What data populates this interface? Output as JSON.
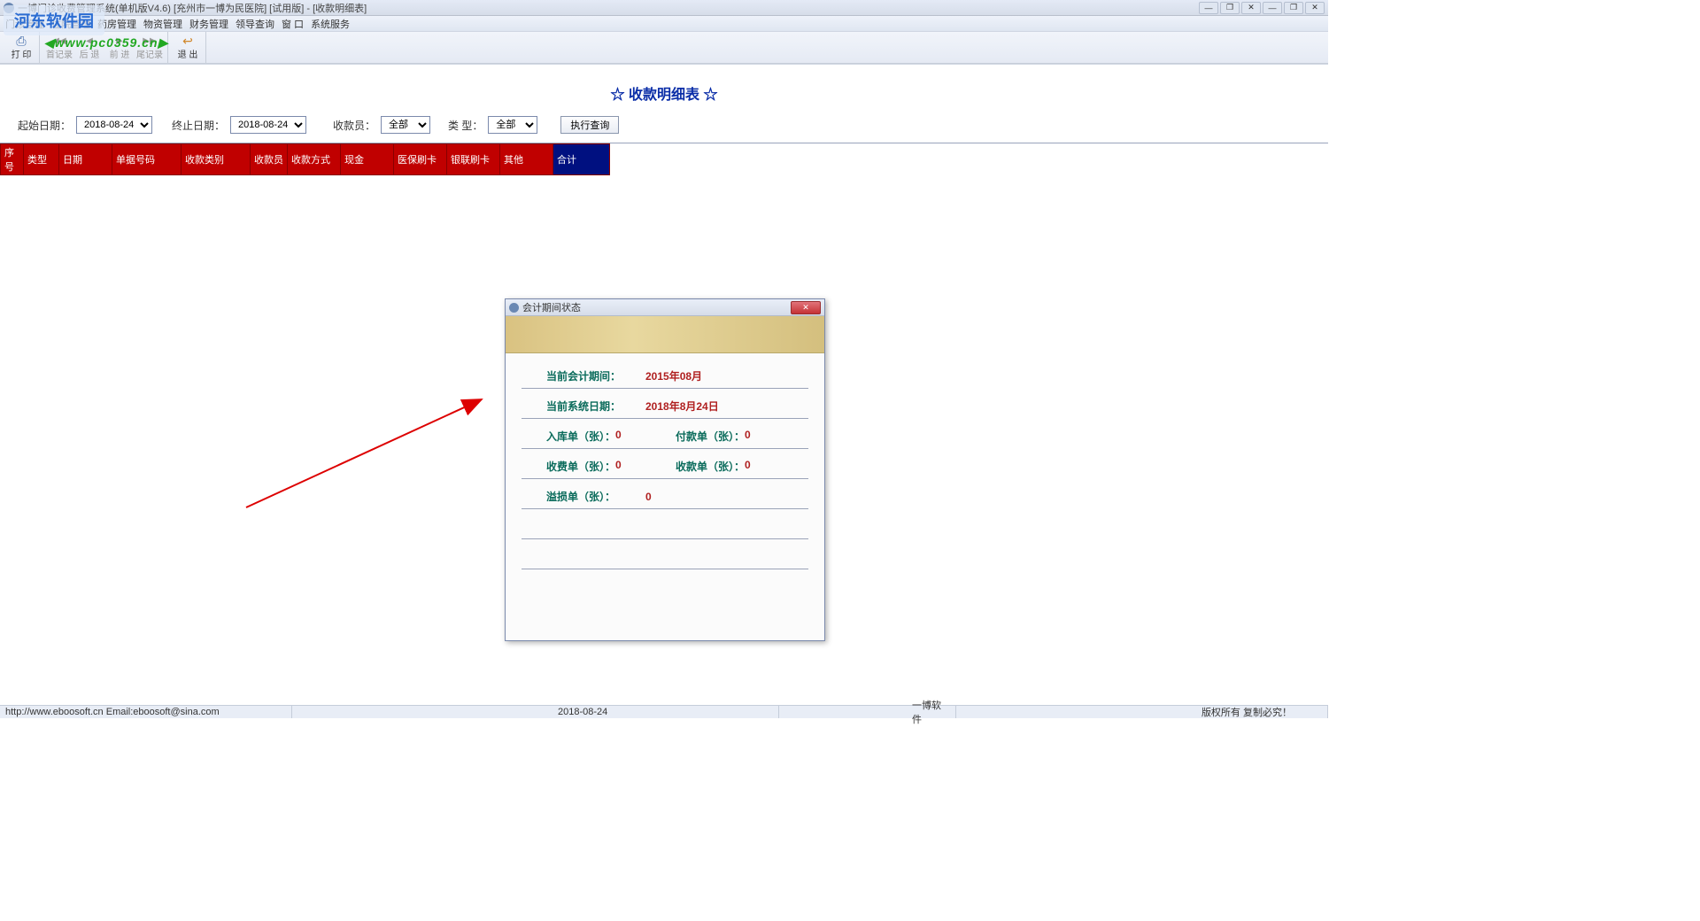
{
  "window": {
    "title": "一博门诊收费管理系统(单机版V4.6)    [充州市一博为民医院]  [试用版] - [收款明细表]"
  },
  "watermark": {
    "logo": "河东软件园",
    "url": "◀www.pc0359.cn▶"
  },
  "menus": [
    "门诊管理",
    "住院管理",
    "药房管理",
    "物资管理",
    "财务管理",
    "领导查询",
    "窗 口",
    "系统服务"
  ],
  "toolbar": {
    "print": "打 印",
    "first": "首记录",
    "back": "后 退",
    "forward": "前 进",
    "last": "尾记录",
    "exit": "退 出"
  },
  "page_title": "☆  收款明细表  ☆",
  "filters": {
    "start_label": "起始日期：",
    "start_value": "2018-08-24",
    "end_label": "终止日期：",
    "end_value": "2018-08-24",
    "cashier_label": "收款员：",
    "cashier_value": "全部",
    "type_label": "类  型：",
    "type_value": "全部",
    "run": "执行查询"
  },
  "table": {
    "columns": [
      "序号",
      "类型",
      "日期",
      "单据号码",
      "收款类别",
      "收款员",
      "收款方式",
      "现金",
      "医保刷卡",
      "银联刷卡",
      "其他",
      "合计"
    ]
  },
  "dialog": {
    "title": "会计期间状态",
    "rows": {
      "period_label": "当前会计期间：",
      "period_value": "2015年08月",
      "sysdate_label": "当前系统日期：",
      "sysdate_value": "2018年8月24日",
      "in_label": "入库单（张）：",
      "in_value": "0",
      "pay_label": "付款单（张）：",
      "pay_value": "0",
      "fee_label": "收费单（张）：",
      "fee_value": "0",
      "recv_label": "收款单（张）：",
      "recv_value": "0",
      "over_label": "溢损单（张）：",
      "over_value": "0"
    }
  },
  "status": {
    "url": "http://www.eboosoft.cn   Email:eboosoft@sina.com",
    "date": "2018-08-24",
    "soft": "一博软件",
    "copy": "版权所有  复制必究！"
  }
}
